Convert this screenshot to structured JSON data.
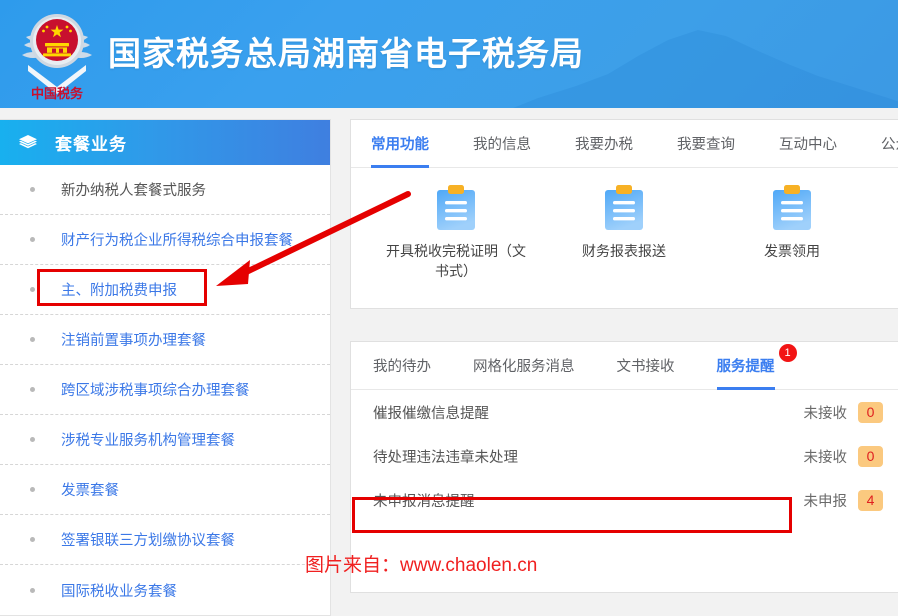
{
  "header": {
    "title": "国家税务总局湖南省电子税务局",
    "logo_icon": "china-tax-emblem-icon",
    "background_icon": "mountain-silhouette-icon",
    "bg_color": "#3a9ce9"
  },
  "sidebar": {
    "header": {
      "label": "套餐业务",
      "icon": "layers-stack-icon"
    },
    "items": [
      {
        "label": "新办纳税人套餐式服务",
        "link": false
      },
      {
        "label": "财产行为税企业所得税综合申报套餐",
        "link": true
      },
      {
        "label": "主、附加税费申报",
        "link": true,
        "highlighted": true
      },
      {
        "label": "注销前置事项办理套餐",
        "link": true
      },
      {
        "label": "跨区域涉税事项综合办理套餐",
        "link": true
      },
      {
        "label": "涉税专业服务机构管理套餐",
        "link": true
      },
      {
        "label": "发票套餐",
        "link": true
      },
      {
        "label": "签署银联三方划缴协议套餐",
        "link": true
      },
      {
        "label": "国际税收业务套餐",
        "link": true
      }
    ]
  },
  "main": {
    "top_panel": {
      "tabs": [
        {
          "label": "常用功能",
          "active": true
        },
        {
          "label": "我的信息",
          "active": false
        },
        {
          "label": "我要办税",
          "active": false
        },
        {
          "label": "我要查询",
          "active": false
        },
        {
          "label": "互动中心",
          "active": false
        },
        {
          "label": "公众",
          "active": false
        }
      ],
      "shortcuts": [
        {
          "label": "开具税收完税证明（文书式）",
          "icon": "clipboard-icon"
        },
        {
          "label": "财务报表报送",
          "icon": "clipboard-icon"
        },
        {
          "label": "发票领用",
          "icon": "clipboard-icon"
        }
      ]
    },
    "bottom_panel": {
      "tabs": [
        {
          "label": "我的待办",
          "active": false,
          "badge": ""
        },
        {
          "label": "网格化服务消息",
          "active": false,
          "badge": ""
        },
        {
          "label": "文书接收",
          "active": false,
          "badge": ""
        },
        {
          "label": "服务提醒",
          "active": true,
          "badge": "1"
        }
      ],
      "reminders": [
        {
          "title": "催报催缴信息提醒",
          "status": "未接收",
          "count": "0",
          "highlighted": false
        },
        {
          "title": "待处理违法违章未处理",
          "status": "未接收",
          "count": "0",
          "highlighted": false
        },
        {
          "title": "未申报消息提醒",
          "status": "未申报",
          "count": "4",
          "highlighted": true
        }
      ]
    }
  },
  "annotations": {
    "arrow_icon": "red-arrow-icon",
    "box_color": "#e50000",
    "watermark_prefix": "图片来自：",
    "watermark_url": "www.chaolen.cn",
    "watermark_color": "#f02020"
  }
}
